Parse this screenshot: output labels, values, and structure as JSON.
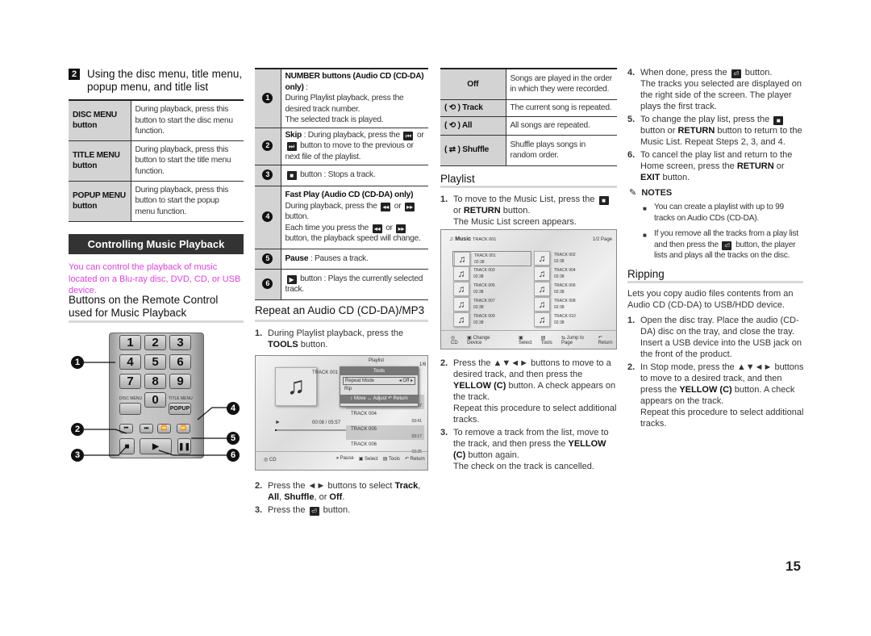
{
  "col1": {
    "section_badge": "2",
    "section_title_line1": "Using the disc menu, title menu,",
    "section_title_line2": "popup menu, and title list",
    "menu_table": [
      {
        "key": "DISC MENU button",
        "desc": "During playback, press this button to start the disc menu function."
      },
      {
        "key": "TITLE MENU button",
        "desc": "During playback, press this button to start the title menu function."
      },
      {
        "key": "POPUP MENU button",
        "desc": "During playback, press this button to start the popup menu function."
      }
    ],
    "banner": "Controlling Music Playback",
    "intro": "You can control the playback of music located on a Blu-ray disc, DVD, CD, or USB device.",
    "intro_color": "#e040e0",
    "remote_heading": "Buttons on the Remote Control used for Music Playback",
    "remote": {
      "keys": [
        "1",
        "2",
        "3",
        "4",
        "5",
        "6",
        "7",
        "8",
        "9",
        "0"
      ],
      "disc_menu_label": "DISC MENU",
      "title_menu_label": "TITLE MENU",
      "popup": "POPUP",
      "callouts": [
        "1",
        "2",
        "3",
        "4",
        "5",
        "6"
      ]
    }
  },
  "col2": {
    "button_table": [
      {
        "num": "1",
        "lines": [
          [
            {
              "b": "NUMBER buttons (Audio CD (CD-DA) only)"
            },
            " :"
          ],
          [
            "During Playlist playback, press the desired track number."
          ],
          [
            "The selected track is played."
          ]
        ]
      },
      {
        "num": "2",
        "lines": [
          [
            {
              "b": "Skip"
            },
            " : During playback, press the ",
            {
              "icon": "skip-back-icon"
            },
            " or ",
            {
              "icon": "skip-forward-icon"
            },
            " button to move to the previous or next file of the playlist."
          ]
        ]
      },
      {
        "num": "3",
        "lines": [
          [
            {
              "icon": "stop-icon"
            },
            " button : Stops a track."
          ]
        ]
      },
      {
        "num": "4",
        "lines": [
          [
            {
              "b": "Fast Play (Audio CD (CD-DA) only)"
            }
          ],
          [
            "During playback, press the ",
            {
              "icon": "rewind-icon"
            },
            " or ",
            {
              "icon": "fast-forward-icon"
            },
            " button."
          ],
          [
            "Each time you press the ",
            {
              "icon": "rewind-icon"
            },
            " or ",
            {
              "icon": "fast-forward-icon"
            },
            " button, the playback speed will change."
          ]
        ]
      },
      {
        "num": "5",
        "lines": [
          [
            {
              "b": "Pause"
            },
            " : Pauses a track."
          ]
        ]
      },
      {
        "num": "6",
        "lines": [
          [
            {
              "icon": "play-icon"
            },
            " button : Plays the currently selected track."
          ]
        ]
      }
    ],
    "repeat_heading": "Repeat an Audio CD (CD-DA)/MP3",
    "steps_before": [
      {
        "n": "1.",
        "lines": [
          [
            "During Playlist playback, press the ",
            {
              "b": "TOOLS"
            },
            " button."
          ]
        ]
      }
    ],
    "tools_screen": {
      "playlist_label": "Playlist",
      "page": "1/6",
      "now_playing": "TRACK 001",
      "time": "00:08 / 05:57",
      "menu_title": "Tools",
      "menu_items": [
        {
          "label": "Repeat Mode",
          "value": "Off"
        },
        {
          "label": "Rip",
          "value": ""
        }
      ],
      "menu_hint": "↕ Move  ↔ Adjust  ↶ Return",
      "tracks": [
        {
          "name": "",
          "time": "04:07"
        },
        {
          "name": "TRACK 004",
          "time": "03:41"
        },
        {
          "name": "TRACK 005",
          "time": "03:17"
        },
        {
          "name": "TRACK 006",
          "time": "03:35"
        }
      ],
      "source": "CD",
      "footer": [
        "Pause",
        "Select",
        "Tools",
        "Return"
      ]
    },
    "steps_after": [
      {
        "n": "2.",
        "lines": [
          [
            "Press the ◄► buttons to select ",
            {
              "b": "Track"
            },
            ", ",
            {
              "b": "All"
            },
            ", ",
            {
              "b": "Shuffle"
            },
            ", or ",
            {
              "b": "Off"
            },
            "."
          ]
        ]
      },
      {
        "n": "3.",
        "lines": [
          [
            "Press the ",
            {
              "icon": "enter-icon"
            },
            " button."
          ]
        ]
      }
    ]
  },
  "col3": {
    "repeat_table": [
      {
        "key": "Off",
        "desc": "Songs are played in the order in which they were recorded."
      },
      {
        "key": "( ⟲ ) Track",
        "desc": "The current song is repeated."
      },
      {
        "key": "( ⟲ ) All",
        "desc": "All songs are repeated."
      },
      {
        "key": "( ⇄ ) Shuffle",
        "desc": "Shuffle plays songs in random order."
      }
    ],
    "playlist_heading": "Playlist",
    "steps_before": [
      {
        "n": "1.",
        "lines": [
          [
            "To move to the Music List, press the ",
            {
              "icon": "stop-icon"
            },
            " or ",
            {
              "b": "RETURN"
            },
            " button."
          ],
          [
            "The Music List screen appears."
          ]
        ]
      }
    ],
    "music_screen": {
      "title": "Music",
      "current": "TRACK 001",
      "page": "1/2 Page",
      "tracks": [
        {
          "name": "TRACK 001",
          "time": "02:38"
        },
        {
          "name": "TRACK 002",
          "time": "02:38"
        },
        {
          "name": "TRACK 003",
          "time": "02:38"
        },
        {
          "name": "TRACK 004",
          "time": "02:38"
        },
        {
          "name": "TRACK 005",
          "time": "02:38"
        },
        {
          "name": "TRACK 006",
          "time": "02:38"
        },
        {
          "name": "TRACK 007",
          "time": "02:38"
        },
        {
          "name": "TRACK 008",
          "time": "02:38"
        },
        {
          "name": "TRACK 009",
          "time": "02:38"
        },
        {
          "name": "TRACK 010",
          "time": "02:38"
        }
      ],
      "source": "CD",
      "footer": [
        "Change Device",
        "Select",
        "Tools",
        "Jump to Page",
        "Return"
      ]
    },
    "steps_after": [
      {
        "n": "2.",
        "lines": [
          [
            "Press the ▲▼◄► buttons to move to a desired track, and then press the ",
            {
              "b": "YELLOW (C)"
            },
            " button. A check appears on the track."
          ],
          [
            "Repeat this procedure to select additional tracks."
          ]
        ]
      },
      {
        "n": "3.",
        "lines": [
          [
            "To remove a track from the list, move to the track, and then press the ",
            {
              "b": "YELLOW (C)"
            },
            " button again."
          ],
          [
            "The check on the track is cancelled."
          ]
        ]
      }
    ]
  },
  "col4": {
    "steps": [
      {
        "n": "4.",
        "lines": [
          [
            "When done, press the ",
            {
              "icon": "enter-icon"
            },
            " button."
          ],
          [
            "The tracks you selected are displayed on the right side of the screen. The player plays the first track."
          ]
        ]
      },
      {
        "n": "5.",
        "lines": [
          [
            "To change the play list, press the ",
            {
              "icon": "stop-icon"
            },
            " button or ",
            {
              "b": "RETURN"
            },
            " button to return to the Music List. Repeat Steps 2, 3, and 4."
          ]
        ]
      },
      {
        "n": "6.",
        "lines": [
          [
            "To cancel the play list and return to the Home screen, press the ",
            {
              "b": "RETURN"
            },
            " or ",
            {
              "b": "EXIT"
            },
            " button."
          ]
        ]
      }
    ],
    "notes_label": "NOTES",
    "notes": [
      [
        [
          "You can create a playlist with up to 99 tracks on Audio CDs (CD-DA)."
        ]
      ],
      [
        [
          "If you remove all the tracks from a play list and then press the ",
          {
            "icon": "enter-icon"
          },
          " button, the player lists and plays all the tracks on the disc."
        ]
      ]
    ],
    "ripping_heading": "Ripping",
    "ripping_intro": "Lets you copy audio files contents from an Audio CD (CD-DA) to USB/HDD device.",
    "ripping_steps": [
      {
        "n": "1.",
        "lines": [
          [
            "Open the disc tray. Place the audio (CD-DA) disc on the tray, and close the tray. Insert a USB device into the USB jack on the front of the product."
          ]
        ]
      },
      {
        "n": "2.",
        "lines": [
          [
            "In Stop mode, press the ▲▼◄► buttons to move to a desired track, and then press the ",
            {
              "b": "YELLOW (C)"
            },
            " button. A check appears on the track."
          ],
          [
            "Repeat this procedure to select additional tracks."
          ]
        ]
      }
    ]
  },
  "page_number": "15"
}
